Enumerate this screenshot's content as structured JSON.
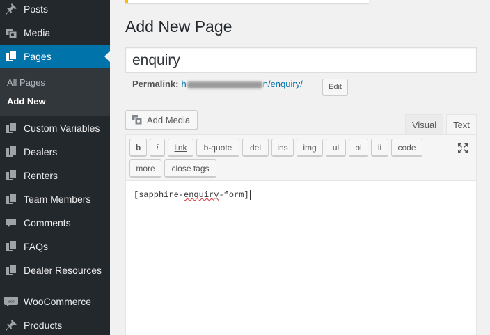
{
  "sidebar": {
    "items": [
      {
        "key": "posts",
        "label": "Posts",
        "icon": "pin-icon"
      },
      {
        "key": "media",
        "label": "Media",
        "icon": "media-icon"
      },
      {
        "key": "pages",
        "label": "Pages",
        "icon": "pages-icon",
        "current": true
      },
      {
        "key": "custom-variables",
        "label": "Custom Variables",
        "icon": "doc-icon"
      },
      {
        "key": "dealers",
        "label": "Dealers",
        "icon": "doc-icon"
      },
      {
        "key": "renters",
        "label": "Renters",
        "icon": "doc-icon"
      },
      {
        "key": "team-members",
        "label": "Team Members",
        "icon": "doc-icon"
      },
      {
        "key": "comments",
        "label": "Comments",
        "icon": "comment-icon"
      },
      {
        "key": "faqs",
        "label": "FAQs",
        "icon": "doc-icon"
      },
      {
        "key": "dealer-resources",
        "label": "Dealer Resources",
        "icon": "doc-icon"
      },
      {
        "key": "woocommerce",
        "label": "WooCommerce",
        "icon": "woo-icon"
      },
      {
        "key": "products",
        "label": "Products",
        "icon": "pin-icon"
      }
    ],
    "submenu": {
      "all_pages": "All Pages",
      "add_new": "Add New"
    }
  },
  "main": {
    "page_title": "Add New Page",
    "title_value": "enquiry",
    "permalink_label": "Permalink:",
    "permalink_prefix": "h",
    "permalink_suffix": "n/enquiry/",
    "edit_label": "Edit",
    "add_media_label": "Add Media",
    "tabs": {
      "visual": "Visual",
      "text": "Text"
    },
    "quicktags": [
      "b",
      "i",
      "link",
      "b-quote",
      "del",
      "ins",
      "img",
      "ul",
      "ol",
      "li",
      "code",
      "more",
      "close tags"
    ],
    "content": {
      "before": "[sapphire-",
      "misspelled": "enquiry",
      "after": "-form]"
    }
  },
  "colors": {
    "sidebar_bg": "#23282d",
    "submenu_bg": "#32373c",
    "accent": "#0073aa",
    "notice": "#ffb900"
  }
}
